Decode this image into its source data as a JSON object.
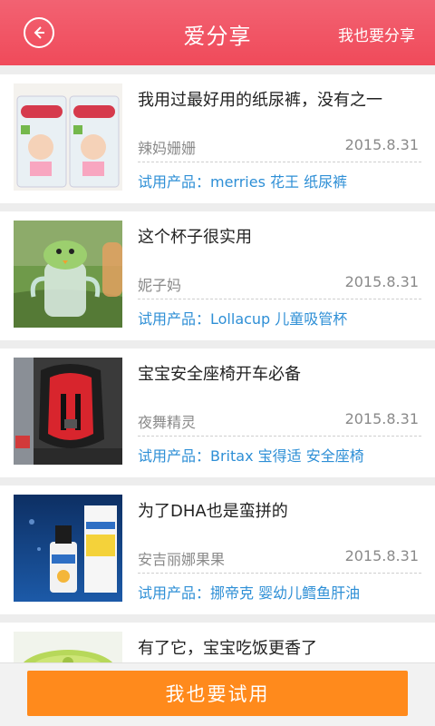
{
  "header": {
    "title": "爱分享",
    "action_label": "我也要分享",
    "back_icon": "back-arrow-icon"
  },
  "feed": {
    "items": [
      {
        "title": "我用过最好用的纸尿裤，没有之一",
        "author": "辣妈姗姗",
        "date": "2015.8.31",
        "product": "试用产品：merries 花王 纸尿裤",
        "thumb": "diaper-pack-image"
      },
      {
        "title": "这个杯子很实用",
        "author": "妮子妈",
        "date": "2015.8.31",
        "product": "试用产品：Lollacup 儿童吸管杯",
        "thumb": "sippy-cup-image"
      },
      {
        "title": "宝宝安全座椅开车必备",
        "author": "夜舞精灵",
        "date": "2015.8.31",
        "product": "试用产品：Britax 宝得适 安全座椅",
        "thumb": "car-seat-image"
      },
      {
        "title": "为了DHA也是蛮拼的",
        "author": "安吉丽娜果果",
        "date": "2015.8.31",
        "product": "试用产品：挪帝克 婴幼儿鳕鱼肝油",
        "thumb": "dha-oil-image"
      },
      {
        "title": "有了它，宝宝吃饭更香了",
        "thumb": "green-bowl-image"
      }
    ]
  },
  "bottom": {
    "button_label": "我也要试用"
  },
  "colors": {
    "header": "#f04a5a",
    "accent_button": "#ff8a1c",
    "link_blue": "#2e8fd6"
  }
}
